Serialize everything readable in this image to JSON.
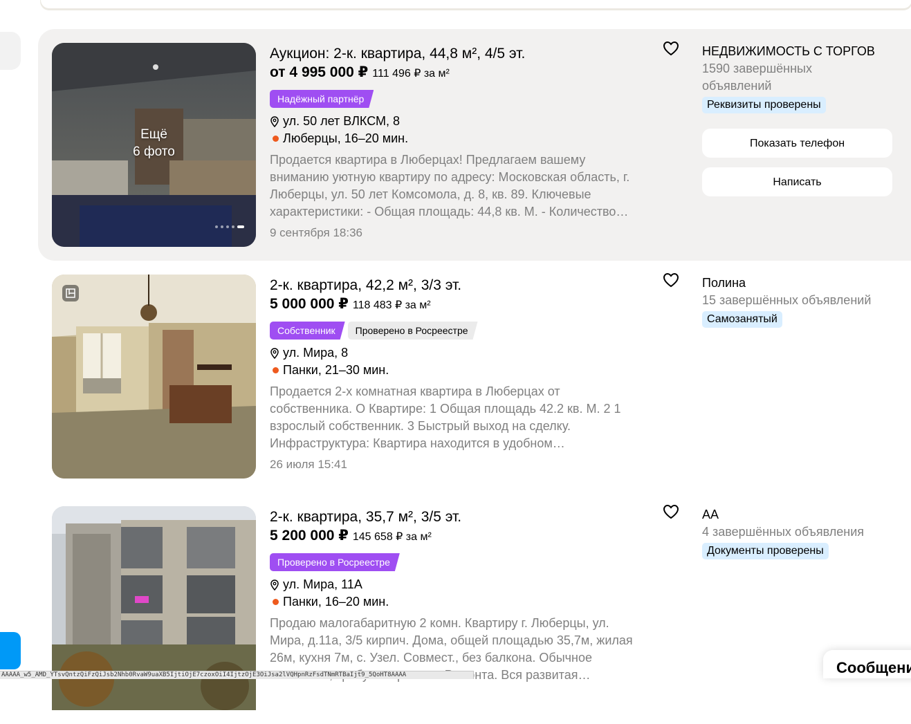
{
  "listings": [
    {
      "title": "Аукцион: 2-к. квартира, 44,8 м², 4/5 эт.",
      "price": "от 4 995 000 ₽",
      "price_per_m2": "111 496 ₽ за м²",
      "badges": [
        "Надёжный партнёр"
      ],
      "address": "ул. 50 лет ВЛКСМ, 8",
      "metro": "Люберцы, 16–20 мин.",
      "description": [
        "Продается квартира в Люберцах! Предлагаем вашему",
        "вниманию уютную квартиру по адресу: Московская область, г.",
        "Люберцы, ул. 50 лет Комсомола, д. 8, кв. 89. Ключевые",
        "характеристики: - Общая площадь: 44,8 кв. М. - Количество…"
      ],
      "date": "9 сентября 18:36",
      "more_photos": [
        "Ещё",
        "6 фото"
      ],
      "seller": {
        "name": "НЕДВИЖИМОСТЬ С ТОРГОВ",
        "stats": [
          "1590 завершённых",
          "объявлений"
        ],
        "tag": "Реквизиты проверены",
        "show_phone": "Показать телефон",
        "write": "Написать"
      }
    },
    {
      "title": "2-к. квартира, 42,2 м², 3/3 эт.",
      "price": "5 000 000 ₽",
      "price_per_m2": "118 483 ₽ за м²",
      "badges": [
        "Собственник",
        "Проверено в Росреестре"
      ],
      "address": "ул. Мира, 8",
      "metro": "Панки, 21–30 мин.",
      "description": [
        "Продается 2-х комнатная квартира в Люберцах от",
        "собственника. О Квартире: 1 Общая площадь 42.2 кв. М. 2 1",
        "взрослый собственник. 3 Быстрый выход на сделку.",
        "Инфраструктура: Квартира находится в удобном…"
      ],
      "date": "26 июля 15:41",
      "seller": {
        "name": "Полина",
        "stats": [
          "15 завершённых объявлений"
        ],
        "tag": "Самозанятый"
      }
    },
    {
      "title": "2-к. квартира, 35,7 м², 3/5 эт.",
      "price": "5 200 000 ₽",
      "price_per_m2": "145 658 ₽ за м²",
      "badges": [
        "Проверено в Росреестре"
      ],
      "address": "ул. Мира, 11А",
      "metro": "Панки, 16–20 мин.",
      "description": [
        "Продаю малогабаритную 2 комн. Квартиру г. Люберцы, ул.",
        "Мира, д.11а, 3/5 кирпич. Дома, общей площадью 35,7м, жилая",
        "26м, кухня 7м, с. Узел. Совмест., без балкона. Обычное",
        "состояние, требуется ремонт. Ремонта. Вся развитая…"
      ],
      "seller": {
        "name": "АА",
        "stats": [
          "4 завершённых объявления"
        ],
        "tag": "Документы проверены"
      }
    }
  ],
  "status_bar_url": "AAAAA_w5_AMD_YTsvQntzQiFzQiJsb2Nhb0RvaW9uaXB5IjtiOjE7czoxOiI4IjtzOjE3OiJsa2lVQHpnRzFsdTNmRTBaIjt9_5QoHT8AAAA",
  "messenger_label": "Сообщения",
  "colors": {
    "badge_purple": "#9f4ef2",
    "tag_blue": "#d9eeff",
    "metro_orange": "#ee5a1e",
    "accent_blue": "#0099f7"
  }
}
